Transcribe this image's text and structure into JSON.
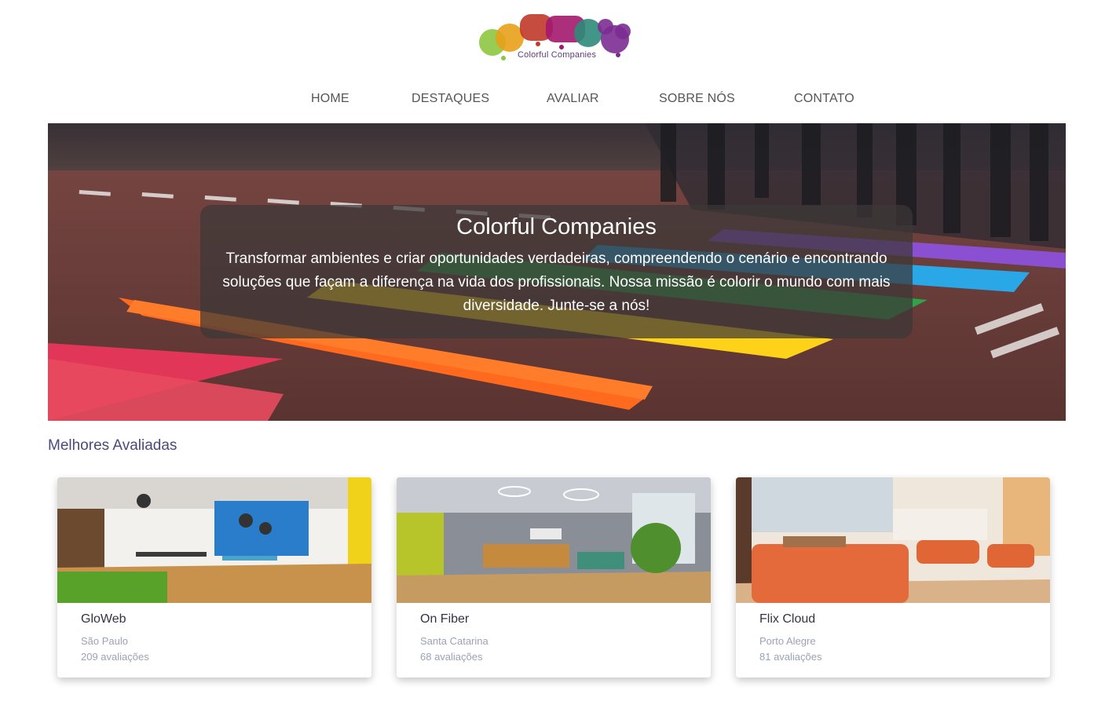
{
  "brand": {
    "logo_text": "Colorful Companies",
    "colors": [
      "#8dc63f",
      "#e8a11a",
      "#c0392b",
      "#a3186e",
      "#2e8b7a",
      "#7b2c91"
    ]
  },
  "nav": {
    "items": [
      {
        "label": "HOME"
      },
      {
        "label": "DESTAQUES"
      },
      {
        "label": "AVALIAR"
      },
      {
        "label": "SOBRE NÓS"
      },
      {
        "label": "CONTATO"
      }
    ]
  },
  "hero": {
    "title": "Colorful Companies",
    "text": "Transformar ambientes e criar oportunidades verdadeiras, compreendendo o cenário e encontrando soluções que façam a diferença na vida dos profissionais. Nossa missão é colorir o mundo com mais diversidade. Junte-se a nós!"
  },
  "section": {
    "title": "Melhores Avaliadas"
  },
  "cards": [
    {
      "name": "GloWeb",
      "city": "São Paulo",
      "reviews": "209 avaliações"
    },
    {
      "name": "On Fiber",
      "city": "Santa Catarina",
      "reviews": "68 avaliações"
    },
    {
      "name": "Flix Cloud",
      "city": "Porto Alegre",
      "reviews": "81 avaliações"
    }
  ]
}
